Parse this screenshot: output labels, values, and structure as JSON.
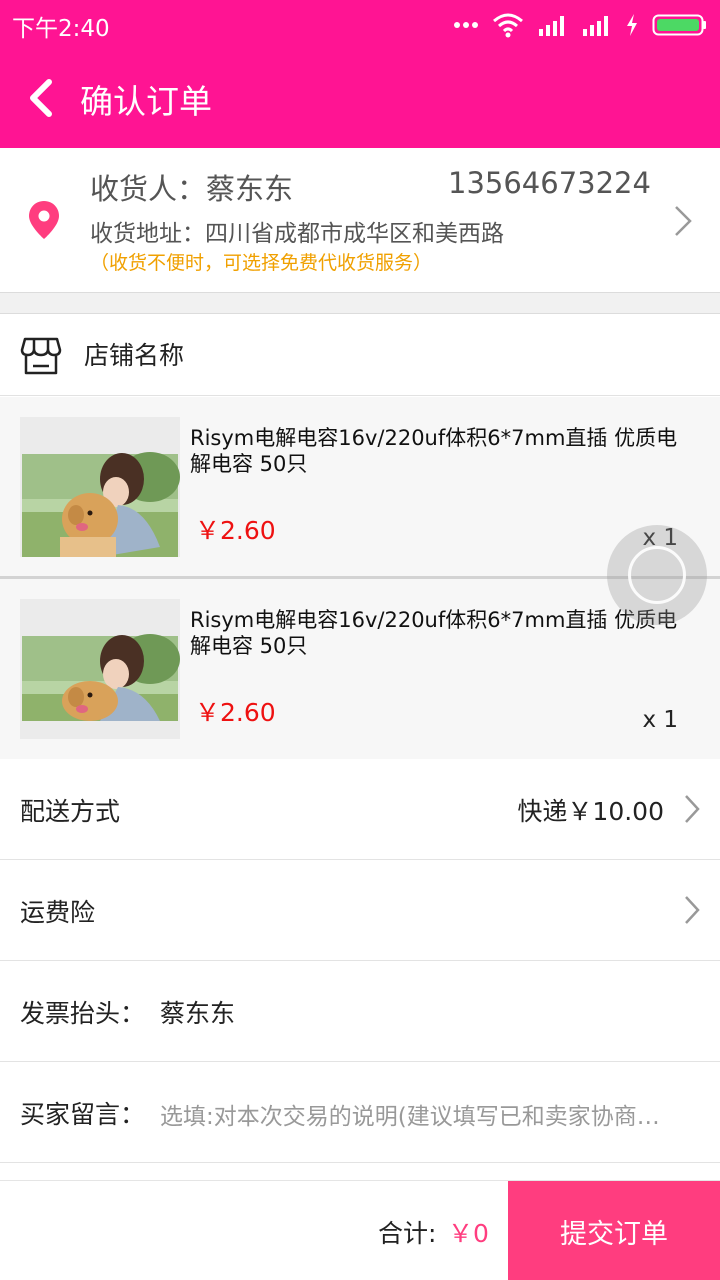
{
  "status_bar": {
    "time": "下午2:40",
    "icons": [
      "more-dots-icon",
      "wifi-icon",
      "signal-icon",
      "signal-icon",
      "charging-icon",
      "battery-icon"
    ]
  },
  "header": {
    "title": "确认订单",
    "back_icon": "chevron-left-icon",
    "color": "#ff1493"
  },
  "address": {
    "recipient_label": "收货人：",
    "recipient_name": "蔡东东",
    "phone": "13564673224",
    "address_label": "收货地址：",
    "address": "四川省成都市成华区和美西路",
    "tip": "（收货不便时，可选择免费代收货服务）"
  },
  "shop": {
    "name": "店铺名称",
    "icon": "store-icon"
  },
  "products": [
    {
      "name": "Risym电解电容16v/220uf体积6*7mm直插 优质电解电容 50只",
      "price": "￥2.60",
      "qty": "x 1"
    },
    {
      "name": "Risym电解电容16v/220uf体积6*7mm直插 优质电解电容 50只",
      "price": "￥2.60",
      "qty": "x 1"
    }
  ],
  "options": {
    "delivery": {
      "label": "配送方式",
      "value": "快递￥10.00"
    },
    "insurance": {
      "label": "运费险"
    },
    "invoice": {
      "label": "发票抬头：",
      "value": "蔡东东"
    },
    "message": {
      "label": "买家留言：",
      "placeholder": "选填:对本次交易的说明(建议填写已和卖家协商一致的内容)"
    }
  },
  "footer": {
    "total_label": "合计:",
    "total_value": "￥0",
    "submit_label": "提交订单"
  },
  "colors": {
    "accent": "#ff1493",
    "submit": "#ff3d7f",
    "price": "#ee1111",
    "tip": "#f0a000"
  }
}
